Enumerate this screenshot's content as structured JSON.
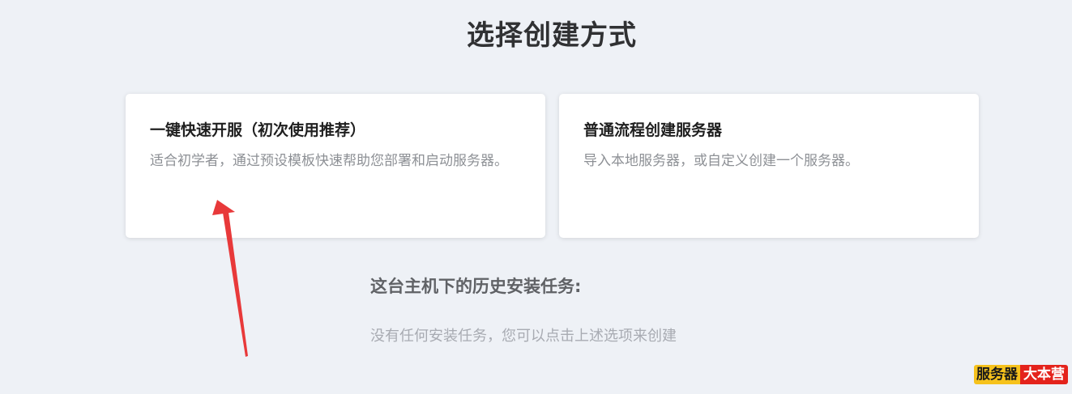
{
  "page": {
    "title": "选择创建方式"
  },
  "options": {
    "quick": {
      "title": "一键快速开服（初次使用推荐）",
      "description": "适合初学者，通过预设模板快速帮助您部署和启动服务器。"
    },
    "normal": {
      "title": "普通流程创建服务器",
      "description": "导入本地服务器，或自定义创建一个服务器。"
    }
  },
  "history": {
    "title": "这台主机下的历史安装任务:",
    "empty_text": "没有任何安装任务，您可以点击上述选项来创建"
  },
  "watermark": {
    "left": "服务器",
    "right": "大本营"
  },
  "colors": {
    "background": "#eef1f6",
    "card": "#ffffff",
    "arrow": "#e8393a",
    "watermark_yellow": "#f6c21c",
    "watermark_red": "#e4231c"
  },
  "annotation": {
    "icon": "red-arrow-icon"
  }
}
